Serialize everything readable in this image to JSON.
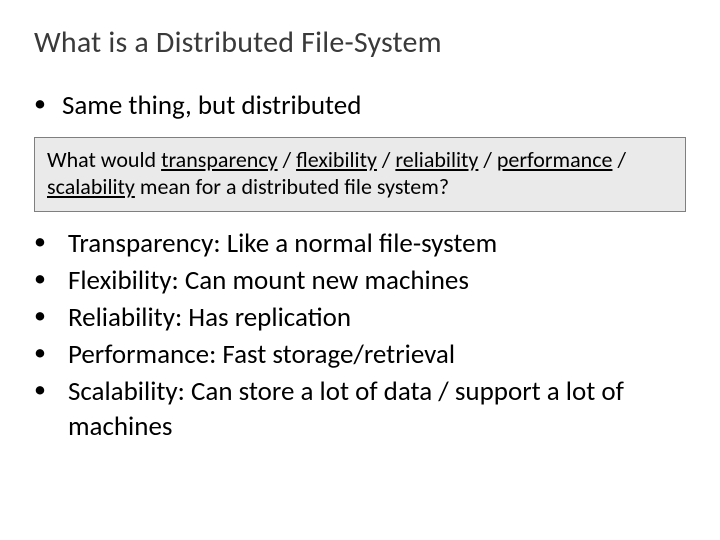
{
  "title": "What is a Distributed File-System",
  "lead": "Same thing, but distributed",
  "callout": {
    "prefix": "What would ",
    "k1": "transparency",
    "k2": "flexibility",
    "k3": "reliability",
    "k4": "performance",
    "k5": "scalability",
    "sep": " / ",
    "suffix": " mean for a distributed file system?"
  },
  "items": [
    {
      "label": "Transparency:",
      "desc": " Like a normal file-system"
    },
    {
      "label": "Flexibility:",
      "desc": " Can mount new machines"
    },
    {
      "label": "Reliability:",
      "desc": " Has replication"
    },
    {
      "label": "Performance:",
      "desc": " Fast storage/retrieval"
    },
    {
      "label": "Scalability:",
      "desc": " Can store a lot of data / support a lot of machines"
    }
  ]
}
